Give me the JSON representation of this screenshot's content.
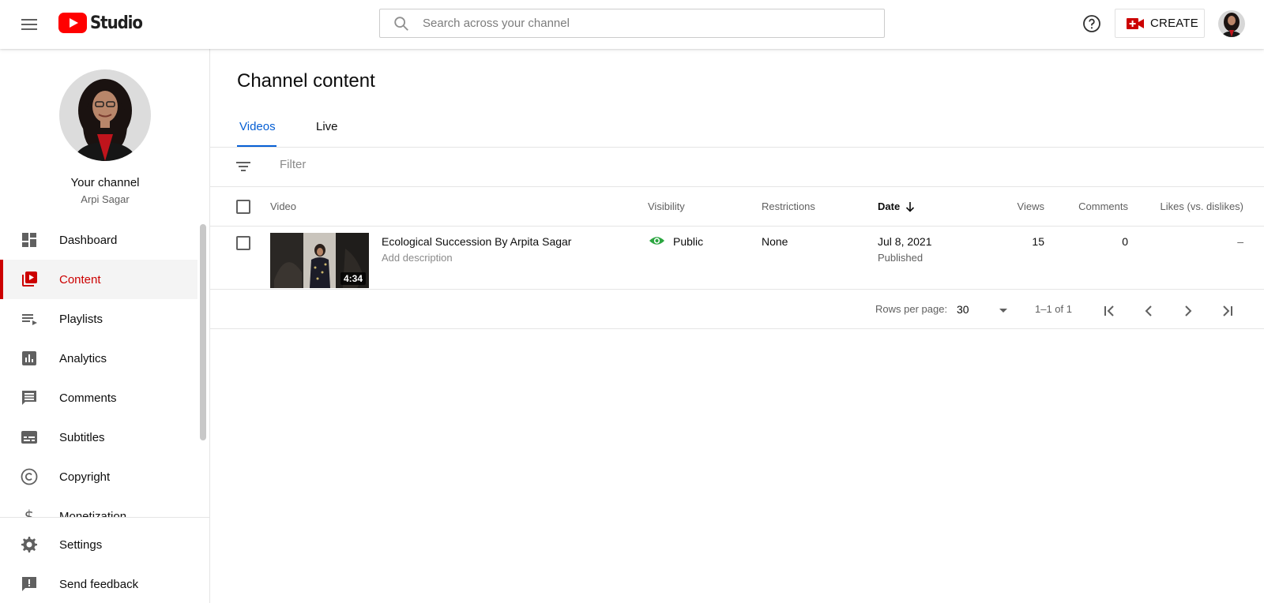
{
  "header": {
    "app_name": "Studio",
    "search_placeholder": "Search across your channel",
    "create_label": "CREATE"
  },
  "sidebar": {
    "your_channel": "Your channel",
    "channel_name": "Arpi Sagar",
    "items": [
      {
        "label": "Dashboard",
        "icon": "dashboard-icon"
      },
      {
        "label": "Content",
        "icon": "content-icon",
        "active": true
      },
      {
        "label": "Playlists",
        "icon": "playlist-icon"
      },
      {
        "label": "Analytics",
        "icon": "analytics-icon"
      },
      {
        "label": "Comments",
        "icon": "comments-icon"
      },
      {
        "label": "Subtitles",
        "icon": "subtitles-icon"
      },
      {
        "label": "Copyright",
        "icon": "copyright-icon"
      },
      {
        "label": "Monetization",
        "icon": "dollar-icon"
      }
    ],
    "bottom_items": [
      {
        "label": "Settings",
        "icon": "gear-icon"
      },
      {
        "label": "Send feedback",
        "icon": "feedback-icon"
      }
    ]
  },
  "main": {
    "title": "Channel content",
    "tabs": [
      {
        "label": "Videos",
        "active": true
      },
      {
        "label": "Live"
      }
    ],
    "filter_placeholder": "Filter",
    "columns": {
      "video": "Video",
      "visibility": "Visibility",
      "restrictions": "Restrictions",
      "date": "Date",
      "views": "Views",
      "comments": "Comments",
      "likes": "Likes (vs. dislikes)"
    },
    "rows": [
      {
        "title": "Ecological Succession By Arpita Sagar",
        "description": "Add description",
        "duration": "4:34",
        "visibility": "Public",
        "restrictions": "None",
        "date": "Jul 8, 2021",
        "date_status": "Published",
        "views": "15",
        "comments": "0",
        "likes": "–"
      }
    ],
    "pagination": {
      "rows_per_page_label": "Rows per page:",
      "rows_per_page": "30",
      "range": "1–1 of 1"
    }
  },
  "colors": {
    "brand_red": "#ff0000",
    "active_red": "#cc0000",
    "tab_blue": "#065fd4",
    "public_green": "#2ba640"
  }
}
